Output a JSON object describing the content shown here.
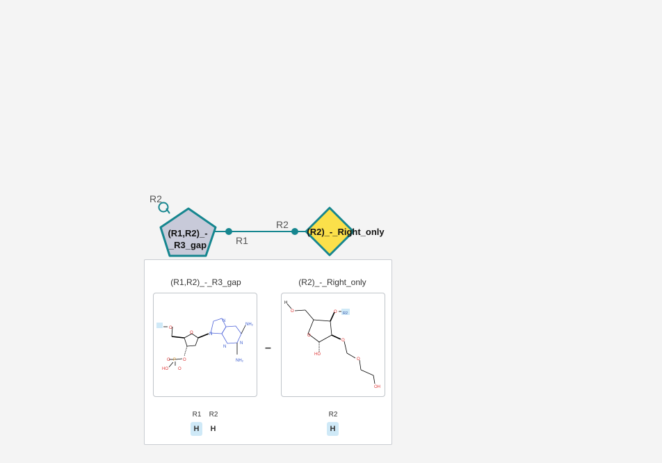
{
  "canvas": {
    "monomer_1": {
      "label_line1": "(R1,R2)_-",
      "label_line2": "_R3_gap",
      "free_rgroup": "R2"
    },
    "monomer_2": {
      "label": "(R2)_-_Right_only"
    },
    "bond": {
      "start_label": "R1",
      "end_label": "R2"
    }
  },
  "detail": {
    "separator": "–",
    "monomer_1": {
      "title": "(R1,R2)_-_R3_gap",
      "rgroups": [
        {
          "name": "R1",
          "value": "H"
        },
        {
          "name": "R2",
          "value": "H"
        }
      ]
    },
    "monomer_2": {
      "title": "(R2)_-_Right_only",
      "rgroups": [
        {
          "name": "R2",
          "value": "H"
        }
      ]
    }
  },
  "structure_labels": {
    "m1": {
      "o_top": "O",
      "o_ring": "O",
      "n1": "N",
      "n2": "N",
      "n3": "N",
      "n4": "N",
      "nh2_top": "NH₂",
      "nh2_bot": "NH₂",
      "ho": "HO",
      "p": "P",
      "o_p1": "O",
      "o_p2": "O",
      "o_p3": "O"
    },
    "m2": {
      "h": "H",
      "o1": "O",
      "o2": "O",
      "r2": "R2",
      "o_ring": "O",
      "ho": "HO",
      "o3": "O",
      "o4": "O",
      "oh": "OH"
    }
  },
  "colors": {
    "teal": "#16868f",
    "sugar_fill": "#c8cad9",
    "diamond_fill": "#fbe04a",
    "highlight": "#cfe9f7"
  }
}
